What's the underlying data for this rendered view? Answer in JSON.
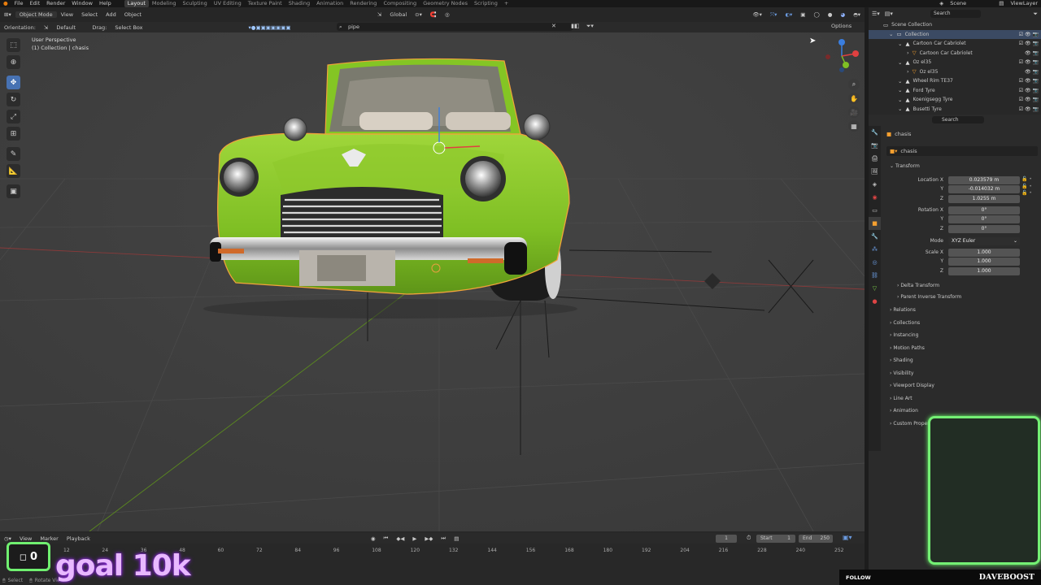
{
  "topbar": {
    "menus": [
      "File",
      "Edit",
      "Render",
      "Window",
      "Help"
    ],
    "workspaces": [
      "Layout",
      "Modeling",
      "Sculpting",
      "UV Editing",
      "Texture Paint",
      "Shading",
      "Animation",
      "Rendering",
      "Compositing",
      "Geometry Nodes",
      "Scripting"
    ],
    "active_workspace": "Layout",
    "add_tab": "+",
    "scene": "Scene",
    "view_layer": "ViewLayer"
  },
  "viewport_header": {
    "mode": "Object Mode",
    "menus": [
      "View",
      "Select",
      "Add",
      "Object"
    ],
    "transform_orientation": "Global",
    "options": "Options"
  },
  "tool_header": {
    "orientation_label": "Orientation:",
    "orientation_value": "Default",
    "drag_label": "Drag:",
    "drag_value": "Select Box",
    "search_value": "pipe"
  },
  "viewport": {
    "perspective": "User Perspective",
    "collection_info": "(1) Collection | chasis"
  },
  "outliner": {
    "search_placeholder": "Search",
    "rows": [
      {
        "label": "Scene Collection",
        "indent": 0,
        "icon": "collection-icon"
      },
      {
        "label": "Collection",
        "indent": 1,
        "icon": "collection-icon",
        "selected": true
      },
      {
        "label": "Cartoon Car Cabriolet",
        "indent": 2,
        "icon": "object-icon"
      },
      {
        "label": "Cartoon Car Cabriolet",
        "indent": 3,
        "icon": "mesh-icon"
      },
      {
        "label": "Oz el35",
        "indent": 2,
        "icon": "object-icon"
      },
      {
        "label": "Oz el35",
        "indent": 3,
        "icon": "mesh-icon"
      },
      {
        "label": "Wheel Rim TE37",
        "indent": 2,
        "icon": "object-icon"
      },
      {
        "label": "Ford Tyre",
        "indent": 2,
        "icon": "object-icon"
      },
      {
        "label": "Koenigsegg Tyre",
        "indent": 2,
        "icon": "object-icon"
      },
      {
        "label": "Busetti Tyre",
        "indent": 2,
        "icon": "object-icon"
      }
    ]
  },
  "properties": {
    "search_placeholder": "Search",
    "breadcrumb": "chasis",
    "object_name": "chasis",
    "transform_title": "Transform",
    "location_label": "Location X",
    "location": [
      "0.023579 m",
      "-0.014032 m",
      "1.0255 m"
    ],
    "rotation_label": "Rotation X",
    "rotation": [
      "0°",
      "0°",
      "0°"
    ],
    "mode_label": "Mode",
    "mode_value": "XYZ Euler",
    "scale_label": "Scale X",
    "scale": [
      "1.000",
      "1.000",
      "1.000"
    ],
    "axis_y": "Y",
    "axis_z": "Z",
    "subsections": [
      "Delta Transform",
      "Parent Inverse Transform"
    ],
    "sections": [
      "Relations",
      "Collections",
      "Instancing",
      "Motion Paths",
      "Shading",
      "Visibility",
      "Viewport Display",
      "Line Art",
      "Animation",
      "Custom Properties"
    ]
  },
  "timeline": {
    "menus": [
      "View",
      "Marker",
      "Playback"
    ],
    "current_frame": "1",
    "start_label": "Start",
    "start": "1",
    "end_label": "End",
    "end": "250",
    "ticks": [
      "12",
      "24",
      "36",
      "48",
      "60",
      "72",
      "84",
      "96",
      "108",
      "120",
      "132",
      "144",
      "156",
      "168",
      "180",
      "192",
      "204",
      "216",
      "228",
      "240",
      "252"
    ]
  },
  "statusbar": {
    "select": "Select",
    "rotate": "Rotate View"
  },
  "overlay": {
    "counter": "0",
    "goal": "goal 10k",
    "follow_label": "FOLLOW",
    "follow_name": "DAVEBOOST"
  },
  "colors": {
    "car_body": "#84c524",
    "selection_outline": "#f2a33a",
    "active_accent": "#4772b3",
    "overlay_green": "#70f070",
    "goal_purple": "#e8b8ff"
  }
}
